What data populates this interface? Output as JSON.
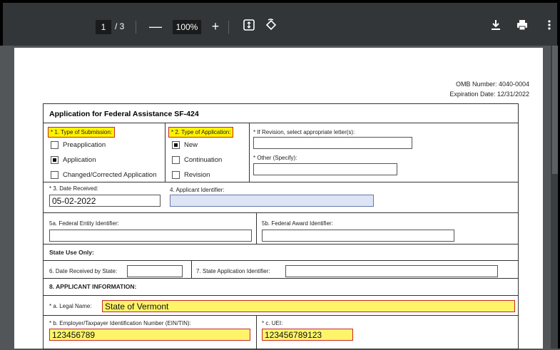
{
  "toolbar": {
    "page_current": "1",
    "page_total": "/ 3",
    "zoom_out": "—",
    "zoom": "100%",
    "zoom_in": "+",
    "fit_icon": "fit-page-icon",
    "rotate_icon": "rotate-icon",
    "download_icon": "download-icon",
    "print_icon": "print-icon",
    "more_icon": "more-vert-icon"
  },
  "header": {
    "omb": "OMB Number: 4040-0004",
    "expiration": "Expiration Date: 12/31/2022"
  },
  "form": {
    "title": "Application for Federal Assistance SF-424",
    "submission": {
      "label": "* 1. Type of Submission:",
      "options": [
        "Preapplication",
        "Application",
        "Changed/Corrected Application"
      ]
    },
    "application": {
      "label": "* 2. Type of Application:",
      "options": [
        "New",
        "Continuation",
        "Revision"
      ]
    },
    "revision_label": "* If Revision, select appropriate letter(s):",
    "other_label": "* Other (Specify):",
    "date_received_label": "* 3. Date Received:",
    "date_received": "05-02-2022",
    "applicant_identifier_label": "4. Applicant Identifier:",
    "federal_entity_label": "5a. Federal Entity Identifier:",
    "federal_award_label": "5b. Federal Award Identifier:",
    "state_use": "State Use Only:",
    "date_state_label": "6. Date Received by State:",
    "state_app_label": "7. State Application Identifier:",
    "applicant_info": "8. APPLICANT INFORMATION:",
    "legal_name_label": "* a. Legal Name:",
    "legal_name": "State of Vermont",
    "ein_label": "* b. Employer/Taxpayer Identification Number (EIN/TIN):",
    "ein": "123456789",
    "uei_label": "* c. UEI:",
    "uei": "123456789123"
  }
}
